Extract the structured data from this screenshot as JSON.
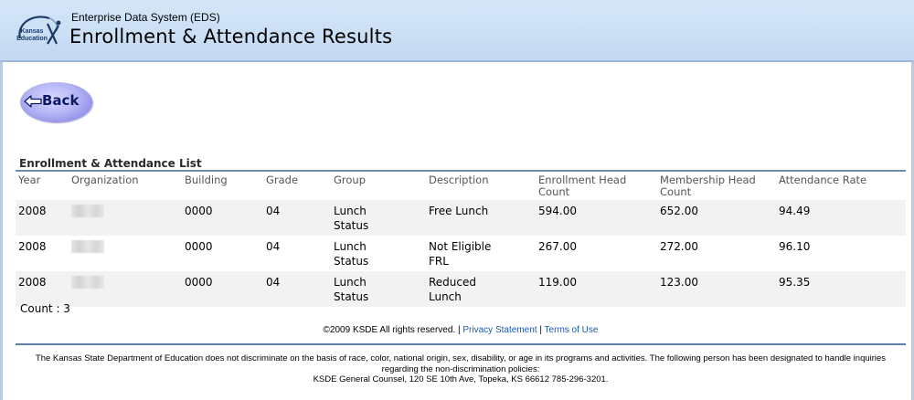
{
  "header": {
    "logo_line1": "Kansas",
    "logo_line2": "Education",
    "system_name": "Enterprise Data System (EDS)",
    "page_title": "Enrollment & Attendance Results"
  },
  "back_button": {
    "label": "Back"
  },
  "list": {
    "title": "Enrollment & Attendance List",
    "columns": [
      "Year",
      "Organization",
      "Building",
      "Grade",
      "Group",
      "Description",
      "Enrollment Head Count",
      "Membership Head Count",
      "Attendance Rate"
    ],
    "rows": [
      {
        "year": "2008",
        "building": "0000",
        "grade": "04",
        "group": "Lunch Status",
        "description": "Free Lunch",
        "enrollment": "594.00",
        "membership": "652.00",
        "attendance": "94.49"
      },
      {
        "year": "2008",
        "building": "0000",
        "grade": "04",
        "group": "Lunch Status",
        "description": "Not Eligible FRL",
        "enrollment": "267.00",
        "membership": "272.00",
        "attendance": "96.10"
      },
      {
        "year": "2008",
        "building": "0000",
        "grade": "04",
        "group": "Lunch Status",
        "description": "Reduced Lunch",
        "enrollment": "119.00",
        "membership": "123.00",
        "attendance": "95.35"
      }
    ],
    "count_label": "Count : 3"
  },
  "footer": {
    "copyright": "©2009 KSDE All rights reserved.",
    "separator": "|",
    "privacy_link": "Privacy Statement",
    "terms_link": "Terms of Use",
    "disclaimer_line1": "The Kansas State Department of Education does not discriminate on the basis of race, color, national origin, sex, disability, or age in its programs and activities. The following person has been designated to handle inquiries regarding the non-discrimination policies:",
    "disclaimer_line2": "KSDE General Counsel, 120 SE 10th Ave, Topeka, KS 66612 785-296-3201."
  },
  "colors": {
    "header_bg": "#c9dcf3",
    "rule_blue": "#6e8bb0",
    "link_blue": "#1a5aa8",
    "back_button_fill": "#b5b5f5"
  },
  "icons": {
    "logo": "kansas-education-logo",
    "back_arrow": "left-arrow-icon"
  }
}
